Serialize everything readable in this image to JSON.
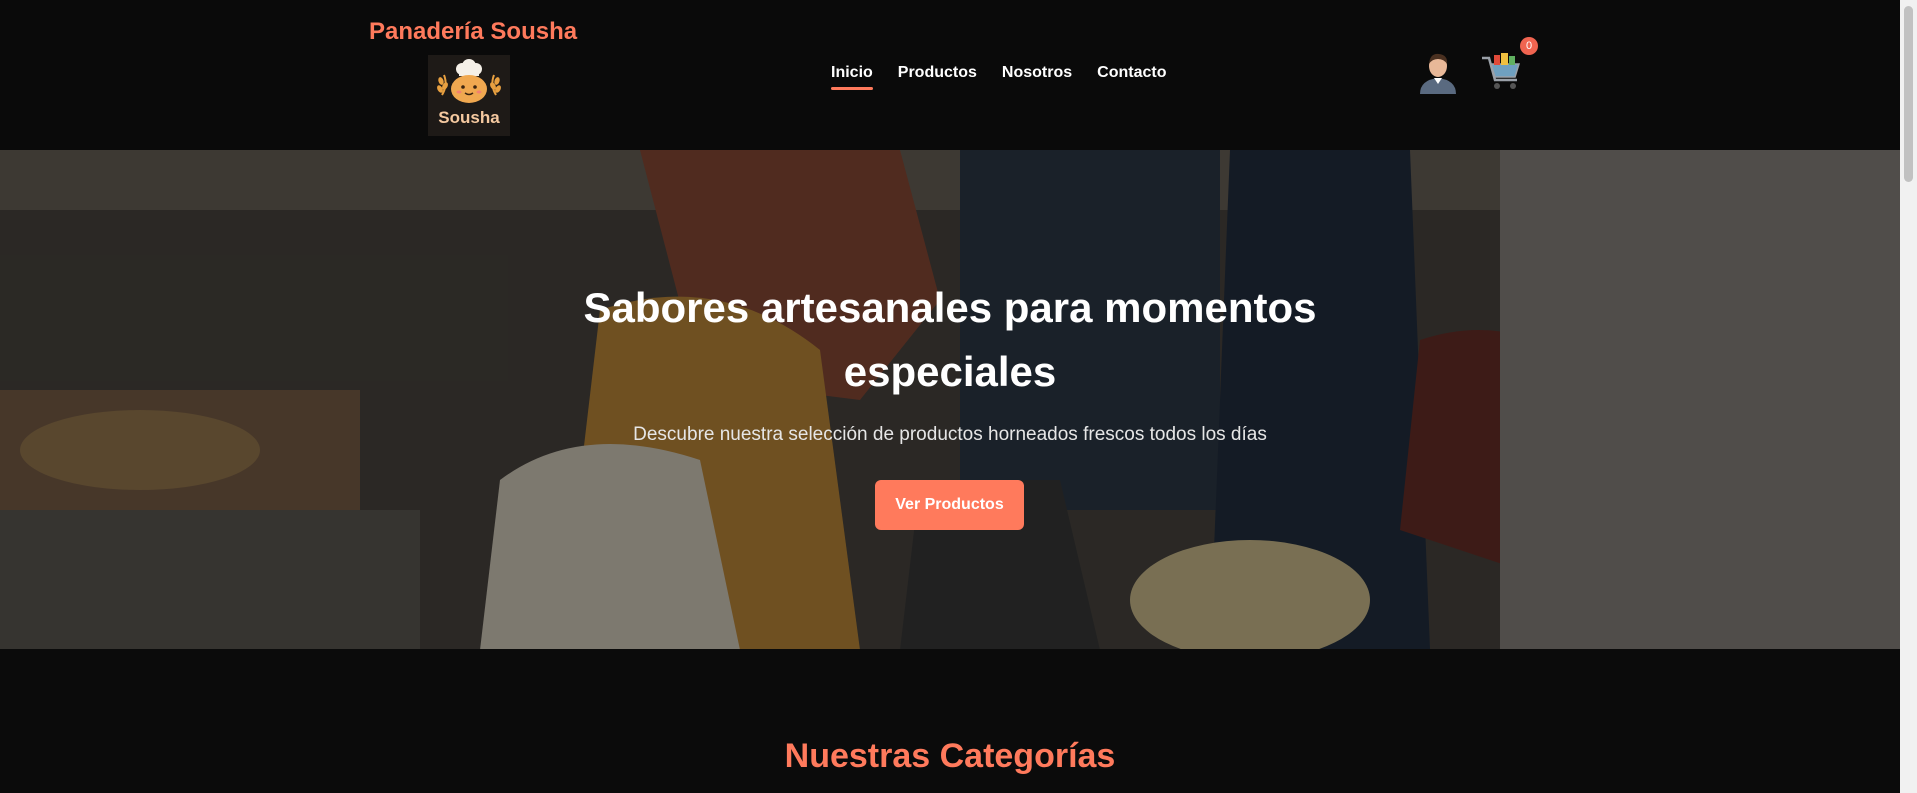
{
  "header": {
    "brand_name": "Panadería Sousha",
    "logo_text": "Sousha",
    "nav": [
      {
        "label": "Inicio",
        "active": true
      },
      {
        "label": "Productos",
        "active": false
      },
      {
        "label": "Nosotros",
        "active": false
      },
      {
        "label": "Contacto",
        "active": false
      }
    ],
    "user_icon": "user-avatar-icon",
    "cart_icon": "shopping-cart-icon",
    "cart_count": "0"
  },
  "hero": {
    "title": "Sabores artesanales para momentos especiales",
    "subtitle": "Descubre nuestra selección de productos horneados frescos todos los días",
    "cta_label": "Ver Productos"
  },
  "categories": {
    "title": "Nuestras Categorías"
  },
  "colors": {
    "accent": "#ff7a5c",
    "background": "#0b0b0b",
    "badge": "#f06450"
  }
}
